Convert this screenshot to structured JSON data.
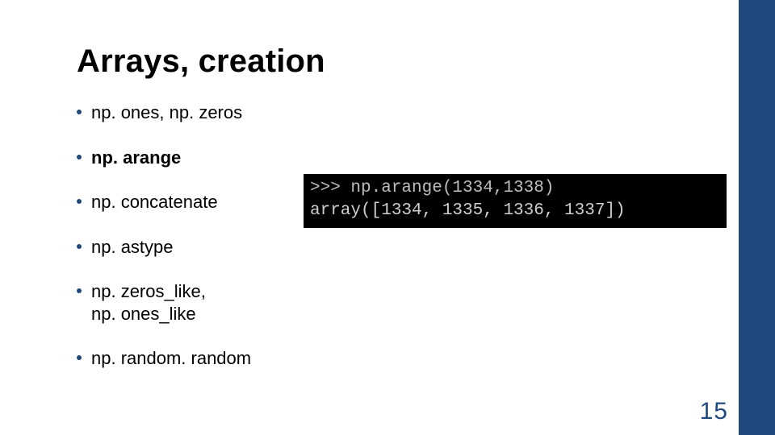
{
  "title": "Arrays, creation",
  "bullets": [
    {
      "text": "np. ones,  np. zeros",
      "bold": false
    },
    {
      "text": "np. arange",
      "bold": true
    },
    {
      "text": "np. concatenate",
      "bold": false
    },
    {
      "text": "np. astype",
      "bold": false
    },
    {
      "text": "np. zeros_like,",
      "line2": "np. ones_like",
      "bold": false,
      "multiline": true
    },
    {
      "text": "np. random. random",
      "bold": false
    }
  ],
  "code": {
    "line1": ">>> np.arange(1334,1338)",
    "line2": "array([1334, 1335, 1336, 1337])"
  },
  "page_number": "15"
}
